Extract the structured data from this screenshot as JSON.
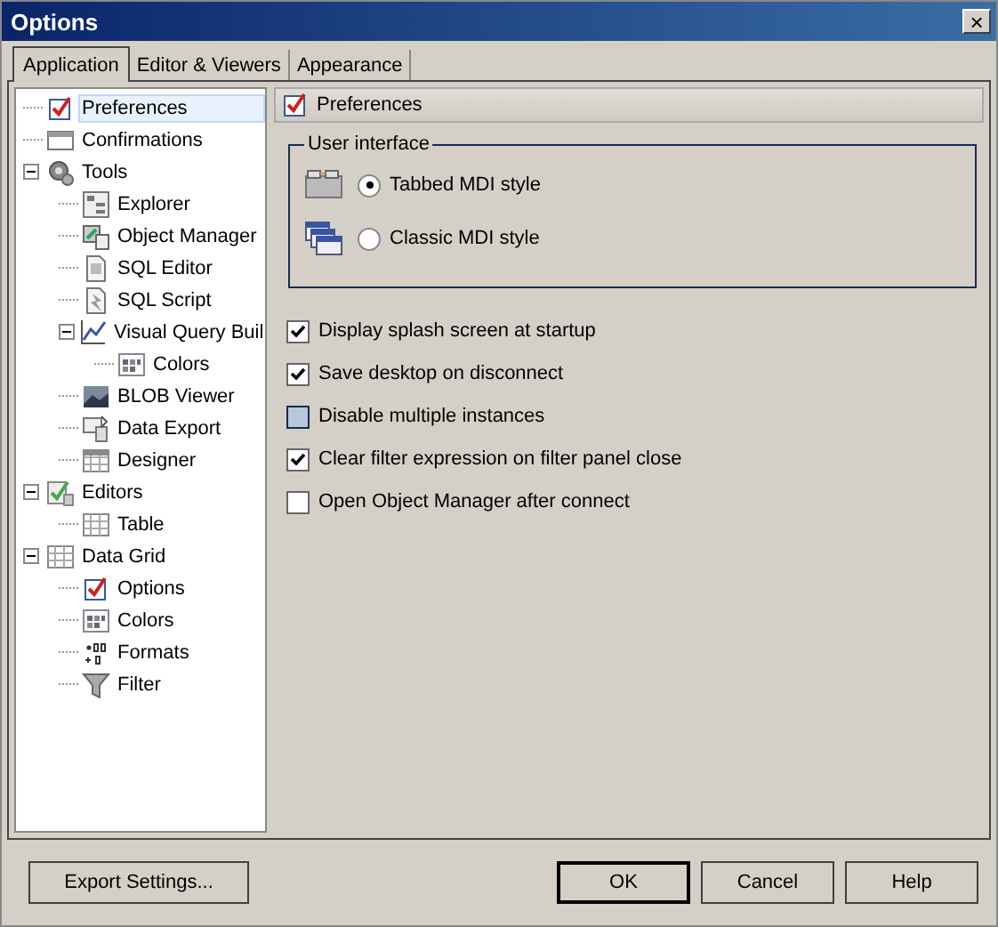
{
  "window": {
    "title": "Options",
    "close": "×"
  },
  "tabs": [
    {
      "label": "Application",
      "selected": true
    },
    {
      "label": "Editor & Viewers",
      "selected": false
    },
    {
      "label": "Appearance",
      "selected": false
    }
  ],
  "tree": {
    "items": [
      {
        "label": "Preferences",
        "kind": "check",
        "selected": true
      },
      {
        "label": "Confirmations",
        "kind": "window",
        "selected": false
      },
      {
        "label": "Tools",
        "kind": "gear",
        "selected": false,
        "expanded": true,
        "children": [
          {
            "label": "Explorer",
            "kind": "tree",
            "selected": false
          },
          {
            "label": "Object Manager",
            "kind": "objects",
            "selected": false
          },
          {
            "label": "SQL Editor",
            "kind": "doc",
            "selected": false
          },
          {
            "label": "SQL Script",
            "kind": "script",
            "selected": false
          },
          {
            "label": "Visual Query Buil",
            "kind": "chart",
            "selected": false,
            "expanded": true,
            "children": [
              {
                "label": "Colors",
                "kind": "palette",
                "selected": false
              }
            ]
          },
          {
            "label": "BLOB Viewer",
            "kind": "picture",
            "selected": false
          },
          {
            "label": "Data Export",
            "kind": "export",
            "selected": false
          },
          {
            "label": "Designer",
            "kind": "calendar",
            "selected": false
          }
        ]
      },
      {
        "label": "Editors",
        "kind": "editors",
        "selected": false,
        "expanded": true,
        "children": [
          {
            "label": "Table",
            "kind": "table",
            "selected": false
          }
        ]
      },
      {
        "label": "Data Grid",
        "kind": "grid",
        "selected": false,
        "expanded": true,
        "children": [
          {
            "label": "Options",
            "kind": "check",
            "selected": false
          },
          {
            "label": "Colors",
            "kind": "palette",
            "selected": false
          },
          {
            "label": "Formats",
            "kind": "format",
            "selected": false
          },
          {
            "label": "Filter",
            "kind": "filter",
            "selected": false
          }
        ]
      }
    ]
  },
  "header": {
    "title": "Preferences"
  },
  "user_interface": {
    "title": "User interface",
    "options": [
      {
        "label": "Tabbed MDI style",
        "kind": "tabbed",
        "selected": true
      },
      {
        "label": "Classic MDI style",
        "kind": "classic",
        "selected": false
      }
    ]
  },
  "checkboxes": [
    {
      "label": "Display splash screen at startup",
      "checked": true,
      "hovered": false
    },
    {
      "label": "Save desktop on disconnect",
      "checked": true,
      "hovered": false
    },
    {
      "label": "Disable multiple instances",
      "checked": false,
      "hovered": true
    },
    {
      "label": "Clear filter expression on filter panel close",
      "checked": true,
      "hovered": false
    },
    {
      "label": "Open Object Manager after connect",
      "checked": false,
      "hovered": false
    }
  ],
  "buttons": {
    "left": [
      {
        "label": "Export Settings...",
        "default": false
      }
    ],
    "right": [
      {
        "label": "OK",
        "default": true
      },
      {
        "label": "Cancel",
        "default": false
      },
      {
        "label": "Help",
        "default": false
      }
    ]
  }
}
